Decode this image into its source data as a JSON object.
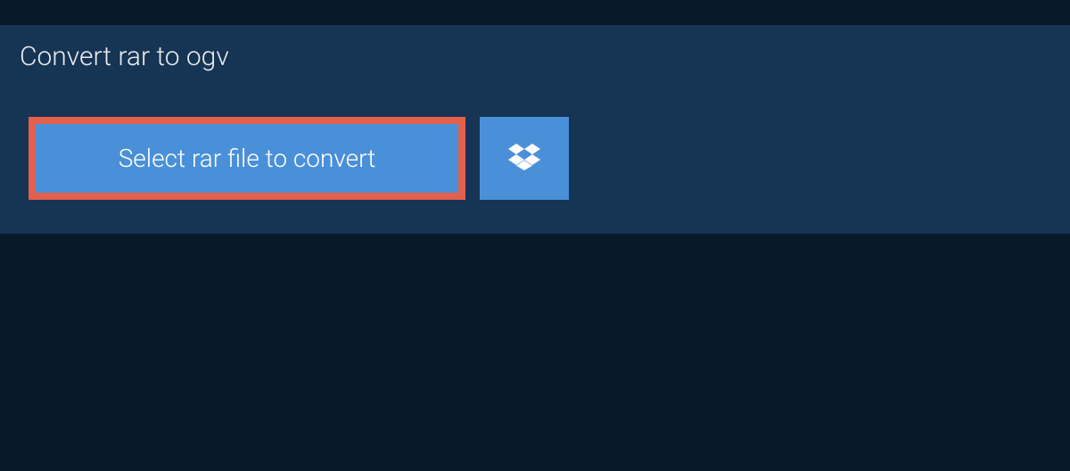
{
  "tab": {
    "title": "Convert rar to ogv"
  },
  "actions": {
    "select_file_label": "Select rar file to convert",
    "dropbox_icon": "dropbox-icon"
  },
  "colors": {
    "background": "#0a1929",
    "panel": "#163453",
    "button": "#4a90d9",
    "highlight_border": "#e4604e"
  }
}
